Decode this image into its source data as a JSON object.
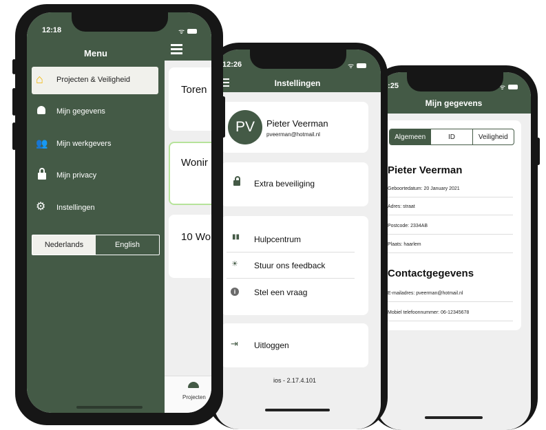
{
  "colors": {
    "brand_green": "#445a46",
    "screen_bg": "#efefef",
    "highlight_border": "#b6e39a"
  },
  "phone1": {
    "time": "12:18",
    "menu_title": "Menu",
    "menu_items": [
      {
        "label": "Projecten & Veiligheid",
        "icon": "house-icon",
        "active": true
      },
      {
        "label": "Mijn gegevens",
        "icon": "worker-icon"
      },
      {
        "label": "Mijn werkgevers",
        "icon": "people-icon"
      },
      {
        "label": "Mijn privacy",
        "icon": "lock-icon"
      },
      {
        "label": "Instellingen",
        "icon": "gear-icon"
      }
    ],
    "lang_nl": "Nederlands",
    "lang_en": "English",
    "cards": [
      "Toren",
      "Wonir",
      "10 Wo"
    ],
    "tab_label": "Projecten"
  },
  "phone2": {
    "time": "12:26",
    "title": "Instellingen",
    "avatar_initials": "PV",
    "user_name": "Pieter Veerman",
    "user_email": "pveerman@hotmail.nl",
    "security_label": "Extra beveiliging",
    "help_items": [
      "Hulpcentrum",
      "Stuur ons feedback",
      "Stel een vraag"
    ],
    "logout_label": "Uitloggen",
    "version": "ios - 2.17.4.101"
  },
  "phone3": {
    "time": "2:25",
    "title": "Mijn gegevens",
    "tabs": [
      "Algemeen",
      "ID",
      "Veiligheid"
    ],
    "name": "Pieter Veerman",
    "details": [
      "Geboortedatum: 20 January 2021",
      "Adres: straat",
      "Postcode: 2334AB",
      "Plaats: haarlem"
    ],
    "contact_heading": "Contactgegevens",
    "contact": [
      "E-mailadres: pveerman@hotmail.nl",
      "Mobiel telefoonnummer: 06-12345678"
    ]
  }
}
